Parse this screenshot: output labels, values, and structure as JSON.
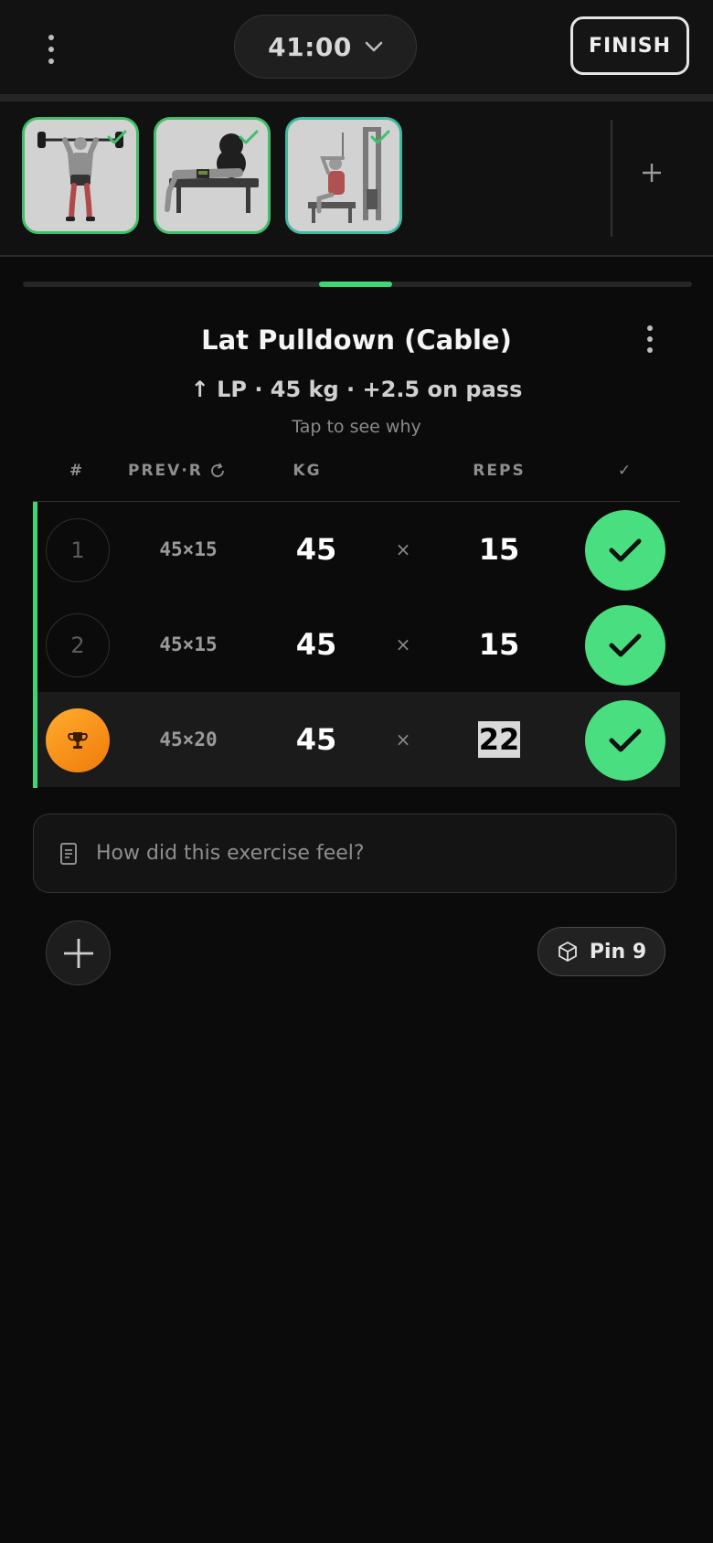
{
  "header": {
    "timer": "41:00",
    "finish_label": "FINISH"
  },
  "exercise_strip": {
    "thumbnails": [
      {
        "name": "barbell-overhead-press",
        "completed": true
      },
      {
        "name": "barbell-bench-press",
        "completed": true
      },
      {
        "name": "lat-pulldown-cable",
        "completed": true,
        "active": true
      }
    ],
    "add_icon": "plus-icon",
    "progress_fraction": 0.11
  },
  "exercise": {
    "title": "Lat Pulldown (Cable)",
    "suggestion": "↑ LP · 45 kg · +2.5 on pass",
    "suggestion_hint": "Tap to see why"
  },
  "table": {
    "headers": {
      "set": "#",
      "prev": "PREV·R",
      "kg": "KG",
      "reps": "REPS",
      "done": "✓"
    },
    "sets": [
      {
        "num": "1",
        "prev": "45×15",
        "kg": "45",
        "times": "×",
        "reps": "15",
        "done": true
      },
      {
        "num": "2",
        "prev": "45×15",
        "kg": "45",
        "times": "×",
        "reps": "15",
        "done": true
      },
      {
        "num": "",
        "badge": "trophy-icon",
        "prev": "45×20",
        "kg": "45",
        "times": "×",
        "reps": "22",
        "done": true,
        "reps_selected": true
      }
    ]
  },
  "notes": {
    "placeholder": "How did this exercise feel?"
  },
  "footer": {
    "pin_label": "Pin 9"
  },
  "colors": {
    "accent": "#49de80",
    "pr_badge": "#f7931e",
    "background": "#0b0b0b"
  }
}
